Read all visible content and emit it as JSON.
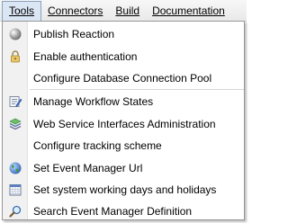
{
  "menubar": {
    "items": [
      {
        "label": "Tools",
        "active": true
      },
      {
        "label": "Connectors"
      },
      {
        "label": "Build"
      },
      {
        "label": "Documentation"
      }
    ]
  },
  "menu": {
    "items": [
      {
        "label": "Publish Reaction",
        "icon": "gray-sphere-icon"
      },
      {
        "label": "Enable authentication",
        "icon": "padlock-icon"
      },
      {
        "label": "Configure Database Connection Pool",
        "icon": ""
      },
      {
        "label": "Manage Workflow States",
        "icon": "edit-list-icon"
      },
      {
        "label": "Web Service Interfaces Administration",
        "icon": "stack-icon"
      },
      {
        "label": "Configure tracking scheme",
        "icon": ""
      },
      {
        "label": "Set Event Manager Url",
        "icon": "globe-icon"
      },
      {
        "label": "Set system working days and holidays",
        "icon": "calendar-icon"
      },
      {
        "label": "Search Event Manager Definition",
        "icon": "search-icon"
      }
    ]
  },
  "colors": {
    "menubar_bg": "#ececec",
    "active_tab_bg": "#dbe6f5",
    "gutter_bg": "#f1f1f1",
    "border": "#979797"
  }
}
